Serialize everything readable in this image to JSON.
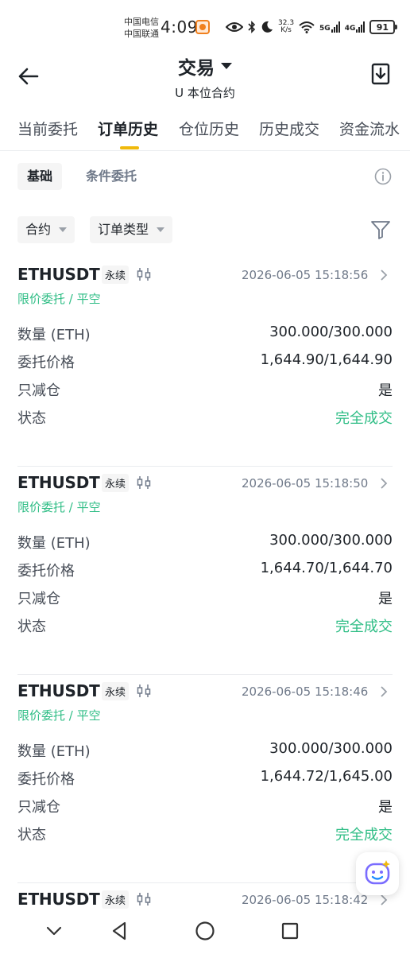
{
  "status_bar": {
    "carrier1": "中国电信",
    "carrier2": "中国联通",
    "time": "4:09",
    "net_speed_value": "32.3",
    "net_speed_unit": "K/s",
    "net1": "5G",
    "net2": "4G",
    "battery": "91"
  },
  "header": {
    "title": "交易",
    "subtitle": "U 本位合约"
  },
  "tabs": [
    {
      "label": "当前委托"
    },
    {
      "label": "订单历史"
    },
    {
      "label": "仓位历史"
    },
    {
      "label": "历史成交"
    },
    {
      "label": "资金流水"
    }
  ],
  "segments": {
    "basic": "基础",
    "conditional": "条件委托"
  },
  "filters": {
    "contract": "合约",
    "order_type": "订单类型"
  },
  "orders": [
    {
      "symbol": "ETHUSDT",
      "perp": "永续",
      "time": "2026-06-05 15:18:56",
      "type": "限价委托 / 平空",
      "qty_label": "数量 (ETH)",
      "qty": "300.000/300.000",
      "price_label": "委托价格",
      "price": "1,644.90/1,644.90",
      "reduce_label": "只减仓",
      "reduce": "是",
      "status_label": "状态",
      "status": "完全成交"
    },
    {
      "symbol": "ETHUSDT",
      "perp": "永续",
      "time": "2026-06-05 15:18:50",
      "type": "限价委托 / 平空",
      "qty_label": "数量 (ETH)",
      "qty": "300.000/300.000",
      "price_label": "委托价格",
      "price": "1,644.70/1,644.70",
      "reduce_label": "只减仓",
      "reduce": "是",
      "status_label": "状态",
      "status": "完全成交"
    },
    {
      "symbol": "ETHUSDT",
      "perp": "永续",
      "time": "2026-06-05 15:18:46",
      "type": "限价委托 / 平空",
      "qty_label": "数量 (ETH)",
      "qty": "300.000/300.000",
      "price_label": "委托价格",
      "price": "1,644.72/1,645.00",
      "reduce_label": "只减仓",
      "reduce": "是",
      "status_label": "状态",
      "status": "完全成交"
    },
    {
      "symbol": "ETHUSDT",
      "perp": "永续",
      "time": "2026-06-05 15:18:42"
    }
  ],
  "colors": {
    "accent": "#f0b90b",
    "buy_green": "#2ebd85"
  }
}
